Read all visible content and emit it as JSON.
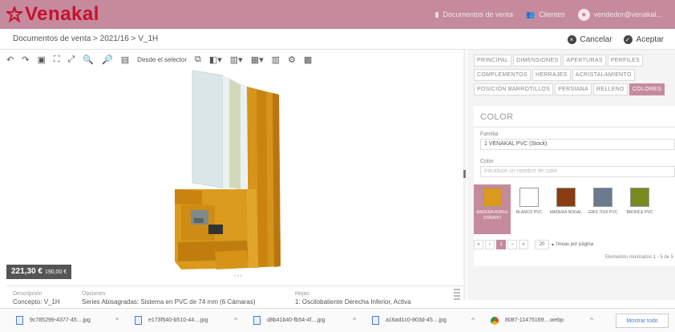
{
  "app": {
    "brand": "Venakal",
    "brand_color": "#c8102e",
    "accent": "#c58a9c"
  },
  "topnav": {
    "documents": "Documentos de venta",
    "clients": "Clientes",
    "user": "vendedor@venakal..."
  },
  "breadcrumb": "Documentos de venta > 2021/16 > V_1H",
  "actions": {
    "cancel": "Cancelar",
    "accept": "Aceptar"
  },
  "toolbar": {
    "from_selector": "Desde el selector"
  },
  "price": {
    "main": "221,30 €",
    "secondary": "190,00 €"
  },
  "info": {
    "desc_label": "Descripción",
    "desc_value": "Concepto: V_1H",
    "options_label": "Opciones",
    "options_value": "Series Abisagradas: Sistema en PVC de 74 mm (6 Cámaras)",
    "leaves_label": "Hojas",
    "leaves_value": "1: Oscilobatiente Derecha Inferior, Activa"
  },
  "tabs": {
    "row1": [
      "PRINCIPAL",
      "DIMENSIONES",
      "APERTURAS",
      "PERFILES"
    ],
    "row2": [
      "COMPLEMENTOS",
      "HERRAJES",
      "ACRISTALAMIENTO"
    ],
    "row3": [
      "POSICIÓN BARROTILLOS",
      "PERSIANA",
      "RELLENO",
      "COLORES"
    ],
    "active": "COLORES"
  },
  "color_card": {
    "title": "COLOR",
    "family_label": "Familia",
    "family_value": "1 VENAKAL PVC (Stock)",
    "color_label": "Color",
    "color_placeholder": "Introduce un nombre de color"
  },
  "swatches": [
    {
      "name": "MADERA ROBLE DORADO",
      "color": "#d99a1e",
      "selected": true
    },
    {
      "name": "BLANCO PVC",
      "color": "#ffffff",
      "selected": false
    },
    {
      "name": "MADERA NOGAL",
      "color": "#8a3b12",
      "selected": false
    },
    {
      "name": "GRIS 7016 PVC",
      "color": "#6b7a8c",
      "selected": false
    },
    {
      "name": "BRONCE PVC",
      "color": "#7a8a1e",
      "selected": false
    }
  ],
  "pager": {
    "current": "1",
    "per_page": "20",
    "per_page_label": "líneas por página",
    "shown": "Elementos mostrados 1 - 5 de 5"
  },
  "downloads": [
    {
      "name": "9c785299-4377-45....jpg",
      "type": "jpg"
    },
    {
      "name": "e173f540-b510-44....jpg",
      "type": "jpg"
    },
    {
      "name": "d8b41b40-fb54-4f....jpg",
      "type": "jpg"
    },
    {
      "name": "a16ad1c0-803d-45....jpg",
      "type": "jpg"
    },
    {
      "name": "8087-11475169....webp",
      "type": "webp"
    }
  ],
  "show_all": "Mostrar todo"
}
